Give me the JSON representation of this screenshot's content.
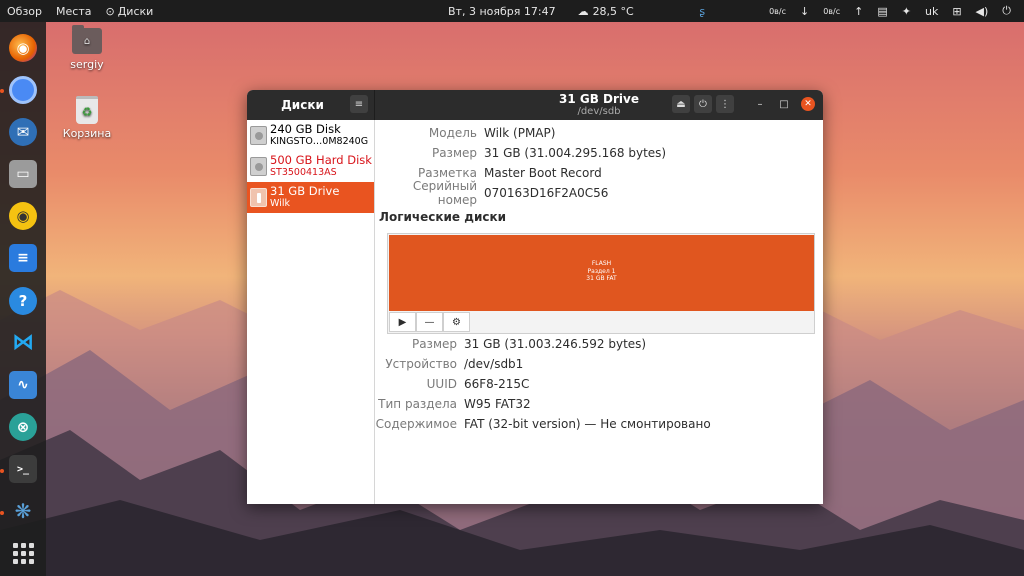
{
  "topbar": {
    "activities": "Обзор",
    "places": "Места",
    "app_menu": "Диски",
    "clock": "Вт, 3 ноября  17:47",
    "weather": "28,5 °C",
    "net_down": "0в/с",
    "net_up": "0в/с",
    "keyboard_layout": "uk"
  },
  "dock": {
    "items": [
      {
        "name": "firefox-icon",
        "color": "#e66000"
      },
      {
        "name": "chromium-icon",
        "color": "#4a8af4"
      },
      {
        "name": "thunderbird-icon",
        "color": "#2f6fb6"
      },
      {
        "name": "files-icon",
        "color": "#9b9b9b"
      },
      {
        "name": "rhythmbox-icon",
        "color": "#f5c211"
      },
      {
        "name": "libreoffice-writer-icon",
        "color": "#2a7bde"
      },
      {
        "name": "help-icon",
        "color": "#2a8ae0"
      },
      {
        "name": "vscode-icon",
        "color": "#23a9f2"
      },
      {
        "name": "system-monitor-icon",
        "color": "#3a85d6"
      },
      {
        "name": "remmina-icon",
        "color": "#2aa198"
      },
      {
        "name": "terminal-icon",
        "color": "#3c3c3c"
      },
      {
        "name": "kde-connect-icon",
        "color": "#5aa0d8"
      }
    ]
  },
  "desktop": {
    "home_label": "sergiy",
    "trash_label": "Корзина"
  },
  "window": {
    "sidebar_title": "Диски",
    "title": "31 GB Drive",
    "subtitle": "/dev/sdb",
    "drives": [
      {
        "name": "240 GB Disk",
        "sub": "KINGSTO…0M8240G",
        "state": "normal"
      },
      {
        "name": "500 GB Hard Disk",
        "sub": "ST3500413AS",
        "state": "warn"
      },
      {
        "name": "31 GB Drive",
        "sub": "Wilk",
        "state": "selected"
      }
    ],
    "drive_props": [
      {
        "key": "Модель",
        "value": "Wilk (PMAP)"
      },
      {
        "key": "Размер",
        "value": "31 GB (31.004.295.168 bytes)"
      },
      {
        "key": "Разметка",
        "value": "Master Boot Record"
      },
      {
        "key": "Серийный номер",
        "value": "070163D16F2A0C56"
      }
    ],
    "volumes_title": "Логические диски",
    "partition": {
      "label": "FLASH",
      "line2": "Раздел 1",
      "line3": "31 GB FAT",
      "color": "#e0561f"
    },
    "partition_props": [
      {
        "key": "Размер",
        "value": "31 GB (31.003.246.592 bytes)"
      },
      {
        "key": "Устройство",
        "value": "/dev/sdb1"
      },
      {
        "key": "UUID",
        "value": "66F8-215C"
      },
      {
        "key": "Тип раздела",
        "value": "W95 FAT32"
      },
      {
        "key": "Содержимое",
        "value": "FAT (32-bit version) — Не смонтировано"
      }
    ]
  }
}
